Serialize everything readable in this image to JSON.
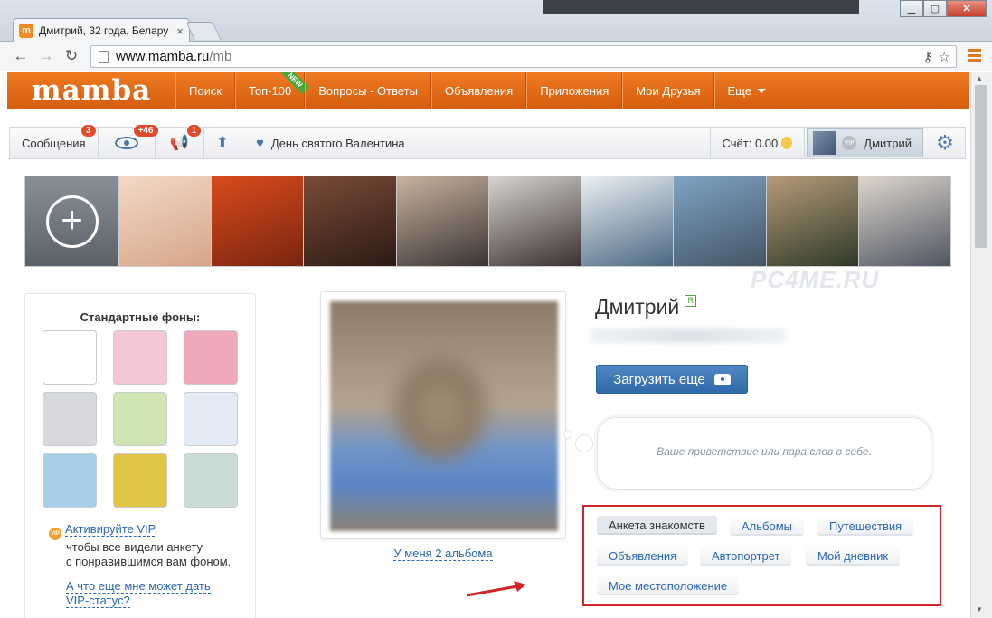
{
  "browser": {
    "tab_title": "Дмитрий, 32 года, Белару",
    "tab_favicon_letter": "m",
    "url_host": "www.mamba.ru",
    "url_path": "/mb"
  },
  "nav": {
    "logo": "mamba",
    "items": [
      {
        "label": "Поиск"
      },
      {
        "label": "Топ-100",
        "ribbon": "NEW"
      },
      {
        "label": "Вопросы - Ответы"
      },
      {
        "label": "Объявления"
      },
      {
        "label": "Приложения"
      },
      {
        "label": "Мои Друзья"
      },
      {
        "label": "Еще"
      }
    ]
  },
  "toolbar": {
    "messages_label": "Сообщения",
    "messages_badge": "3",
    "views_badge": "+46",
    "notify_badge": "1",
    "holiday_label": "День святого Валентина",
    "balance_label": "Счёт: 0.00",
    "user_name": "Дмитрий",
    "vip_mini": "VIP"
  },
  "strip": {
    "photos": [
      {
        "colors": [
          "#f1d9c7",
          "#d7a58a"
        ]
      },
      {
        "colors": [
          "#d94b1c",
          "#7a2510"
        ]
      },
      {
        "colors": [
          "#7a4b38",
          "#2c1a14"
        ]
      },
      {
        "colors": [
          "#c8b29e",
          "#3b3433"
        ]
      },
      {
        "colors": [
          "#d7d3cf",
          "#3a3130"
        ]
      },
      {
        "colors": [
          "#eaf0f4",
          "#4b6781"
        ]
      },
      {
        "colors": [
          "#7fa3c2",
          "#445566"
        ]
      },
      {
        "colors": [
          "#b69a7a",
          "#2f3a28"
        ]
      },
      {
        "colors": [
          "#ddd6cc",
          "#4f5563"
        ]
      }
    ]
  },
  "backgrounds": {
    "title": "Стандартные фоны:",
    "swatches": [
      {
        "bg": "#ffffff"
      },
      {
        "bg": "#f3c8d4"
      },
      {
        "bg": "#efa9bb"
      },
      {
        "bg": "#d7d9dc"
      },
      {
        "bg": "#cfe6b2"
      },
      {
        "bg": "#e5ebf6"
      },
      {
        "bg": "#a7cfe7"
      },
      {
        "bg": "#e1c546"
      },
      {
        "bg": "#c9dcd6"
      }
    ],
    "vip_badge": "VIP",
    "vip_link": "Активируйте VIP",
    "vip_comma": ",",
    "vip_line2": "чтобы все видели анкету",
    "vip_line3": "с понравившимся вам фоном.",
    "vip_question_1": "А что еще мне может дать",
    "vip_question_2": "VIP-статус?"
  },
  "profile": {
    "albums_link": "У меня 2 альбома",
    "name": "Дмитрий",
    "real_badge": "R",
    "upload_button": "Загрузить еще",
    "greeting_placeholder": "Ваше приветствие или пара слов о себе.",
    "sections": [
      {
        "label": "Анкета знакомств",
        "active": true
      },
      {
        "label": "Альбомы",
        "active": false
      },
      {
        "label": "Путешествия",
        "active": false
      },
      {
        "label": "Объявления",
        "active": false
      },
      {
        "label": "Автопортрет",
        "active": false
      },
      {
        "label": "Мой дневник",
        "active": false
      },
      {
        "label": "Мое местоположение",
        "active": false
      }
    ]
  },
  "watermark": "PC4ME.RU",
  "colors": {
    "brand_orange": "#e06a16",
    "link_blue": "#2a67b3",
    "highlight_red": "#d0262a",
    "badge_red": "#e5492b"
  }
}
